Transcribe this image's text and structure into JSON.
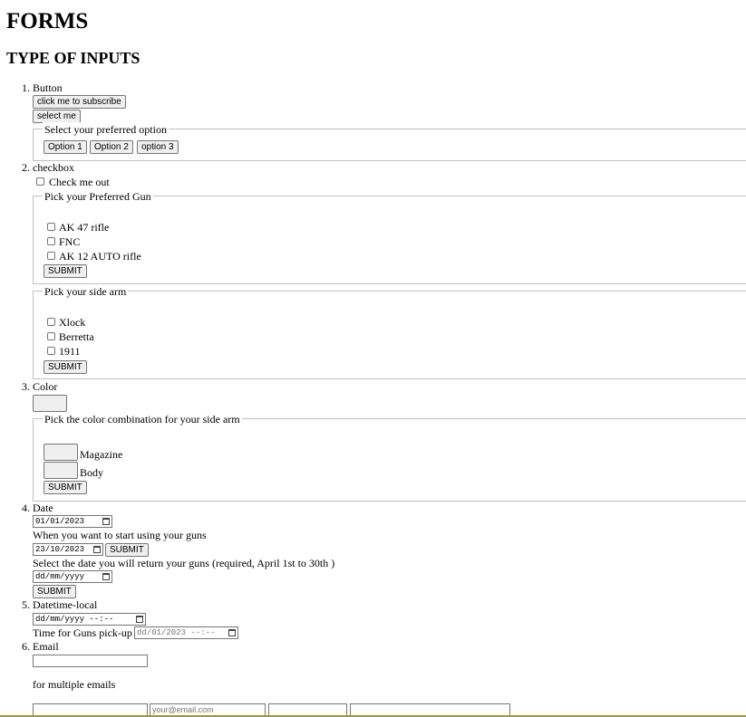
{
  "page": {
    "title": "FORMS",
    "subtitle": "TYPE OF INPUTS"
  },
  "sections": {
    "button": {
      "number": "1.",
      "label": "Button",
      "subscribe": "click me to subscribe",
      "select_me": "select me",
      "legend": "Select your preferred option",
      "options": [
        "Option 1",
        "Option 2",
        "option 3"
      ]
    },
    "checkbox": {
      "number": "2.",
      "label": "checkbox",
      "check_me": "Check me out",
      "gun_legend": "Pick your Preferred Gun",
      "guns": [
        "AK 47 rifle",
        "FNC",
        "AK 12 AUTO rifle"
      ],
      "gun_submit": "SUBMIT",
      "sidearm_legend": "Pick your side arm",
      "sidearms": [
        "Xlock",
        "Berretta",
        "1911"
      ],
      "sidearm_submit": "SUBMIT"
    },
    "color": {
      "number": "3.",
      "label": "Color",
      "default_color": "#000000",
      "legend": "Pick the color combination for your side arm",
      "magazine": "Magazine",
      "body": "Body",
      "submit": "SUBMIT"
    },
    "date": {
      "number": "4.",
      "label": "Date",
      "value1": "01/01/2023",
      "start_label": "When you want to start using your guns",
      "value2": "23/10/2023",
      "submit1": "SUBMIT",
      "return_label": "Select the date you will return your guns (required, April 1st to 30th )",
      "placeholder3": "dd/mm/yyyy",
      "submit2": "SUBMIT"
    },
    "datetime": {
      "number": "5.",
      "label": "Datetime-local",
      "placeholder1": "dd/mm/yyyy --:--",
      "pickup_label": "Time for Guns pick-up",
      "value2": "dd/01/2023 --:--"
    },
    "email": {
      "number": "6.",
      "label": "Email",
      "multiple_label": "for multiple emails",
      "placeholder": "your@email.com"
    }
  },
  "colors": {
    "bottom_bar": "#9a9a3a",
    "button_bg": "#efefef",
    "border": "#767676",
    "fieldset_border": "#c0c0c0"
  }
}
